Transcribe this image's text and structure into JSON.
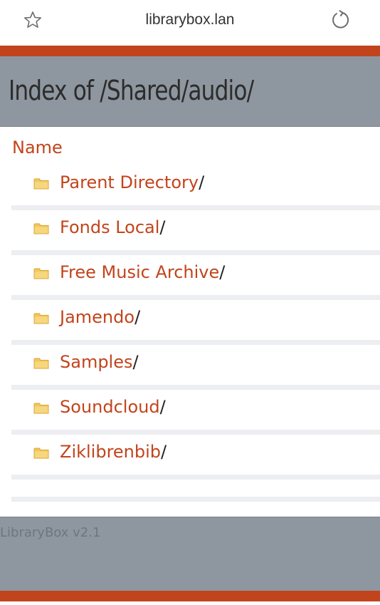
{
  "browser": {
    "url": "librarybox.lan",
    "bookmark_icon": "star-icon",
    "reload_icon": "reload-icon"
  },
  "header": {
    "title": "Index of /Shared/audio/"
  },
  "listing": {
    "column_header": "Name",
    "folder_icon": "folder-icon",
    "entries": [
      {
        "label": "Parent Directory",
        "suffix": "/"
      },
      {
        "label": "Fonds Local",
        "suffix": "/"
      },
      {
        "label": "Free Music Archive",
        "suffix": "/"
      },
      {
        "label": "Jamendo",
        "suffix": "/"
      },
      {
        "label": "Samples",
        "suffix": "/"
      },
      {
        "label": "Soundcloud",
        "suffix": "/"
      },
      {
        "label": "Ziklibrenbib",
        "suffix": "/"
      }
    ]
  },
  "footer": {
    "text": "LibraryBox v2.1"
  },
  "colors": {
    "accent": "#c2441c",
    "band": "#8e969f",
    "separator": "#eceef1",
    "folder": "#f2c75c"
  }
}
